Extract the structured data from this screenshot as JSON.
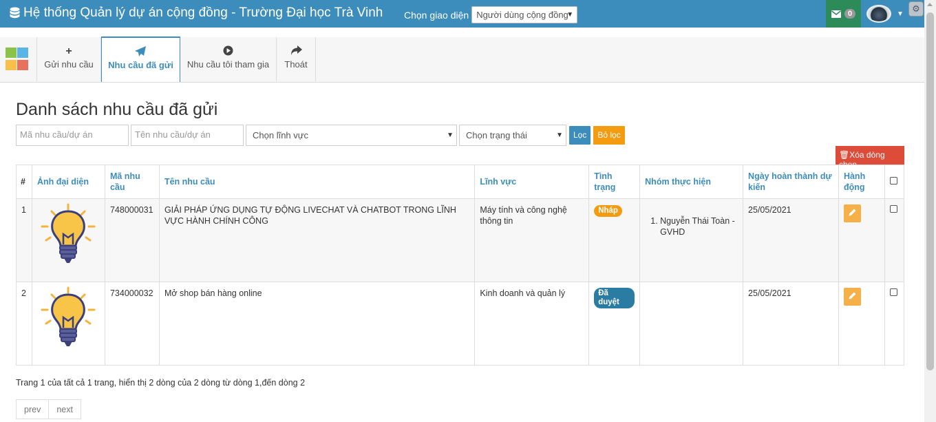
{
  "header": {
    "title": "Hệ thống Quản lý dự án cộng đồng - Trường Đại học Trà Vinh",
    "ui_label": "Chọn giao diện",
    "ui_value": "Người dùng cộng đồng",
    "mail_count": "0",
    "colors": {
      "bar": "#3c8dbc",
      "mail": "#2d8b5a"
    }
  },
  "ribbon": {
    "tabs": [
      {
        "label": "Gửi nhu cầu",
        "icon": "plus-icon"
      },
      {
        "label": "Nhu cầu đã gửi",
        "icon": "paper-plane-icon",
        "active": true
      },
      {
        "label": "Nhu cầu tôi tham gia",
        "icon": "play-circle-icon"
      },
      {
        "label": "Thoát",
        "icon": "share-arrow-icon"
      }
    ]
  },
  "page": {
    "title": "Danh sách nhu cầu đã gửi",
    "filters": {
      "code_placeholder": "Mã nhu cầu/dự án",
      "name_placeholder": "Tên nhu cầu/dự án",
      "field_select": "Chọn lĩnh vực",
      "status_select": "Chọn trạng thái",
      "filter_button": "Lọc",
      "clear_button": "Bỏ lọc"
    },
    "delete_button": "Xóa dòng chọn"
  },
  "table": {
    "headers": {
      "num": "#",
      "image": "Ảnh đại diện",
      "code": "Mã nhu cầu",
      "name": "Tên nhu cầu",
      "field": "Lĩnh vực",
      "status": "Tình trạng",
      "group": "Nhóm thực hiện",
      "date": "Ngày hoàn thành dự kiến",
      "action": "Hành động"
    },
    "rows": [
      {
        "num": "1",
        "code": "748000031",
        "name": "GIẢI PHÁP ỨNG DỤNG TỰ ĐỘNG LIVECHAT VÀ CHATBOT TRONG LĨNH VỰC HÀNH CHÍNH CÔNG",
        "field": "Máy tính và công nghệ thông tin",
        "status": "Nháp",
        "status_color": "#f39c12",
        "group_member": "Nguyễn Thái Toàn - GVHD",
        "date": "25/05/2021"
      },
      {
        "num": "2",
        "code": "734000032",
        "name": "Mở shop bán hàng online",
        "field": "Kinh doanh và quản lý",
        "status": "Đã duyệt",
        "status_color": "#3c8dbc",
        "group_member": "",
        "date": "25/05/2021"
      }
    ]
  },
  "pagination": {
    "info": "Trang 1 của tất cả 1 trang, hiển thị 2 dòng của 2 dòng từ dòng 1,đến dòng 2",
    "prev": "prev",
    "next": "next"
  }
}
